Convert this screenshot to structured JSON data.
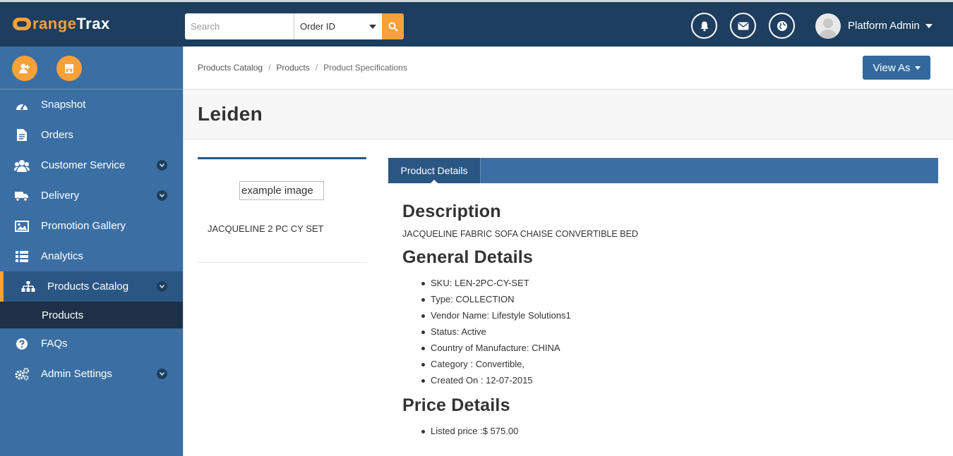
{
  "brand": {
    "logo_orange": "range",
    "logo_white": "Trax",
    "logo_initial": "O"
  },
  "search": {
    "placeholder": "Search",
    "filter_selected": "Order ID"
  },
  "header": {
    "user_name": "Platform Admin"
  },
  "sidebar": {
    "items": [
      {
        "label": "Snapshot",
        "icon": "dashboard-icon"
      },
      {
        "label": "Orders",
        "icon": "document-icon"
      },
      {
        "label": "Customer Service",
        "icon": "users-icon"
      },
      {
        "label": "Delivery",
        "icon": "truck-icon"
      },
      {
        "label": "Promotion Gallery",
        "icon": "image-icon"
      },
      {
        "label": "Analytics",
        "icon": "list-icon"
      },
      {
        "label": "Products Catalog",
        "icon": "sitemap-icon"
      },
      {
        "label": "FAQs",
        "icon": "question-icon"
      },
      {
        "label": "Admin Settings",
        "icon": "gears-icon"
      }
    ],
    "sub_item": "Products"
  },
  "breadcrumb": {
    "items": [
      "Products Catalog",
      "Products",
      "Product Specifications"
    ]
  },
  "toolbar": {
    "view_as": "View As"
  },
  "page": {
    "title": "Leiden"
  },
  "product": {
    "image_alt": "example image",
    "name": "JACQUELINE 2 PC CY SET"
  },
  "tabs": {
    "active": "Product Details"
  },
  "description": {
    "heading": "Description",
    "text": "JACQUELINE FABRIC SOFA CHAISE CONVERTIBLE BED"
  },
  "general": {
    "heading": "General Details",
    "items": [
      "SKU: LEN-2PC-CY-SET",
      "Type: COLLECTION",
      "Vendor Name: Lifestyle Solutions1",
      "Status: Active",
      "Country of Manufacture: CHINA",
      "Category : Convertible,",
      "Created On : 12-07-2015"
    ]
  },
  "price": {
    "heading": "Price Details",
    "items": [
      "Listed price :$ 575.00"
    ]
  },
  "colors": {
    "navy": "#1d3e5e",
    "sidebar_blue": "#3b6fa3",
    "accent_orange": "#f7a13b",
    "active_blue": "#2a5684"
  }
}
